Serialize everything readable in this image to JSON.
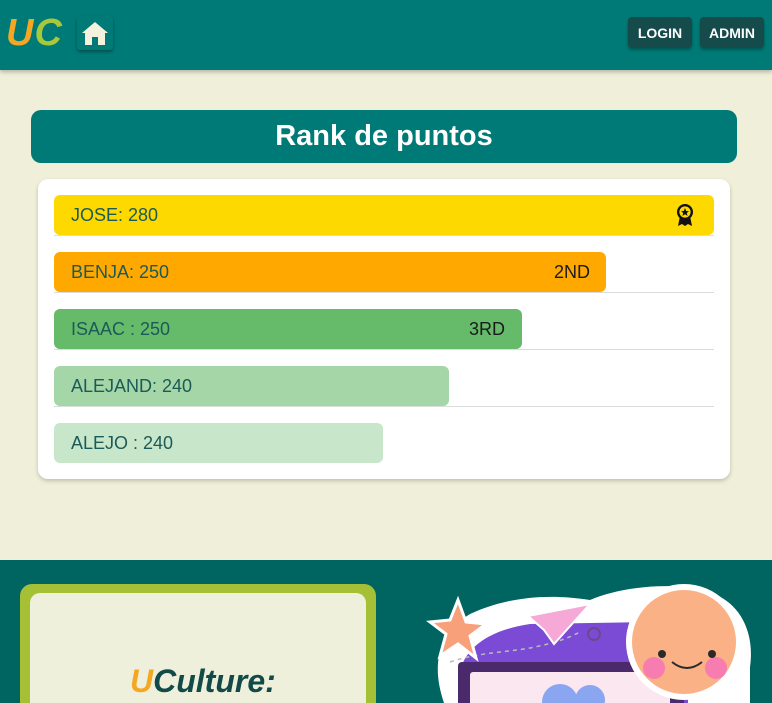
{
  "header": {
    "logo_u": "U",
    "logo_c": "C",
    "login_label": "LOGIN",
    "admin_label": "ADMIN"
  },
  "page_title": "Rank de puntos",
  "ranking": [
    {
      "label": "JOSE: 280",
      "place": "",
      "color": "#fdd900",
      "fill_fraction": 1.0
    },
    {
      "label": "BENJA: 250",
      "place": "2ND",
      "color": "#ffa800",
      "fill_fraction": 0.836
    },
    {
      "label": "ISAAC : 250",
      "place": "3RD",
      "color": "#66bb6a",
      "fill_fraction": 0.709
    },
    {
      "label": "ALEJAND: 240",
      "place": "",
      "color": "#a5d6a7",
      "fill_fraction": 0.598
    },
    {
      "label": "ALEJO : 240",
      "place": "",
      "color": "#c8e6c9",
      "fill_fraction": 0.498
    }
  ],
  "footer": {
    "promo_u": "U",
    "promo_rest": "Culture:"
  },
  "colors": {
    "header_bg": "#007a76",
    "page_bg": "#f0efd9",
    "footer_bg": "#006460",
    "accent_orange": "#f5a623",
    "accent_green": "#a7c83a"
  },
  "icons": [
    "home-icon",
    "award-medal-icon"
  ]
}
